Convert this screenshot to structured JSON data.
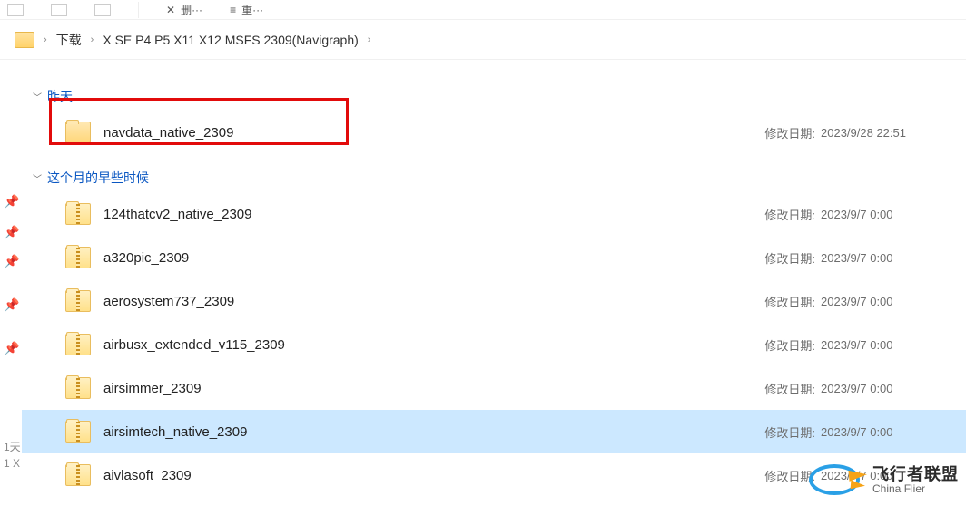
{
  "toolbar": {
    "btn1_partial": "删···",
    "btn2_partial": "重···"
  },
  "breadcrumb": {
    "items": [
      "下载",
      "X SE P4 P5 X11 X12 MSFS 2309(Navigraph)"
    ]
  },
  "groups": [
    {
      "label": "昨天"
    },
    {
      "label": "这个月的早些时候"
    }
  ],
  "mod_label": "修改日期:",
  "rows_g1": [
    {
      "type": "folder",
      "name": "navdata_native_2309",
      "date": "2023/9/28 22:51",
      "selected": false
    }
  ],
  "rows_g2": [
    {
      "type": "zip",
      "name": "124thatcv2_native_2309",
      "date": "2023/9/7 0:00",
      "selected": false
    },
    {
      "type": "zip",
      "name": "a320pic_2309",
      "date": "2023/9/7 0:00",
      "selected": false
    },
    {
      "type": "zip",
      "name": "aerosystem737_2309",
      "date": "2023/9/7 0:00",
      "selected": false
    },
    {
      "type": "zip",
      "name": "airbusx_extended_v115_2309",
      "date": "2023/9/7 0:00",
      "selected": false
    },
    {
      "type": "zip",
      "name": "airsimmer_2309",
      "date": "2023/9/7 0:00",
      "selected": false
    },
    {
      "type": "zip",
      "name": "airsimtech_native_2309",
      "date": "2023/9/7 0:00",
      "selected": true
    },
    {
      "type": "zip",
      "name": "aivlasoft_2309",
      "date": "2023/9/7 0:00",
      "selected": false
    }
  ],
  "status": {
    "line1": "1天",
    "line2": "1 X"
  },
  "watermark": {
    "cn": "飞行者联盟",
    "en": "China Flier"
  }
}
